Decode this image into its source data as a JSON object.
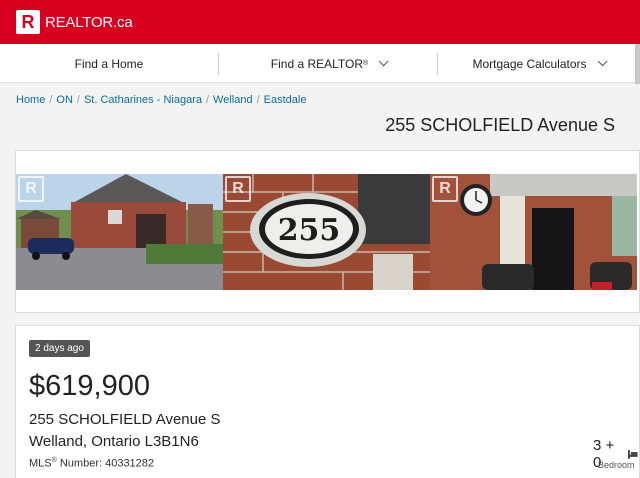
{
  "header": {
    "logo_letter": "R",
    "logo_text": "REALTOR.ca"
  },
  "nav": {
    "items": [
      {
        "label": "Find a Home"
      },
      {
        "label": "Find a REALTOR",
        "suffix": "®"
      },
      {
        "label": "Mortgage Calculators"
      }
    ]
  },
  "breadcrumb": [
    "Home",
    "ON",
    "St. Catharines - Niagara",
    "Welland",
    "Eastdale"
  ],
  "listing": {
    "title": "255 SCHOLFIELD Avenue S",
    "watermark_letter": "R",
    "badge": "2 days ago",
    "price": "$619,900",
    "address_line1": "255 SCHOLFIELD Avenue S",
    "address_line2": "Welland, Ontario L3B1N6",
    "mls_label": "MLS",
    "mls_reg": "®",
    "mls_suffix": " Number: 40331282",
    "bedrooms": "3 + 0",
    "bedrooms_label": "Bedroom"
  },
  "photos": [
    {
      "name": "house-exterior-photo",
      "house_number": ""
    },
    {
      "name": "house-number-sign-photo",
      "house_number": "255"
    },
    {
      "name": "front-porch-photo",
      "house_number": ""
    }
  ],
  "colors": {
    "brand_red": "#d8001f",
    "link_blue": "#0b6e99",
    "badge_gray": "#555555"
  }
}
